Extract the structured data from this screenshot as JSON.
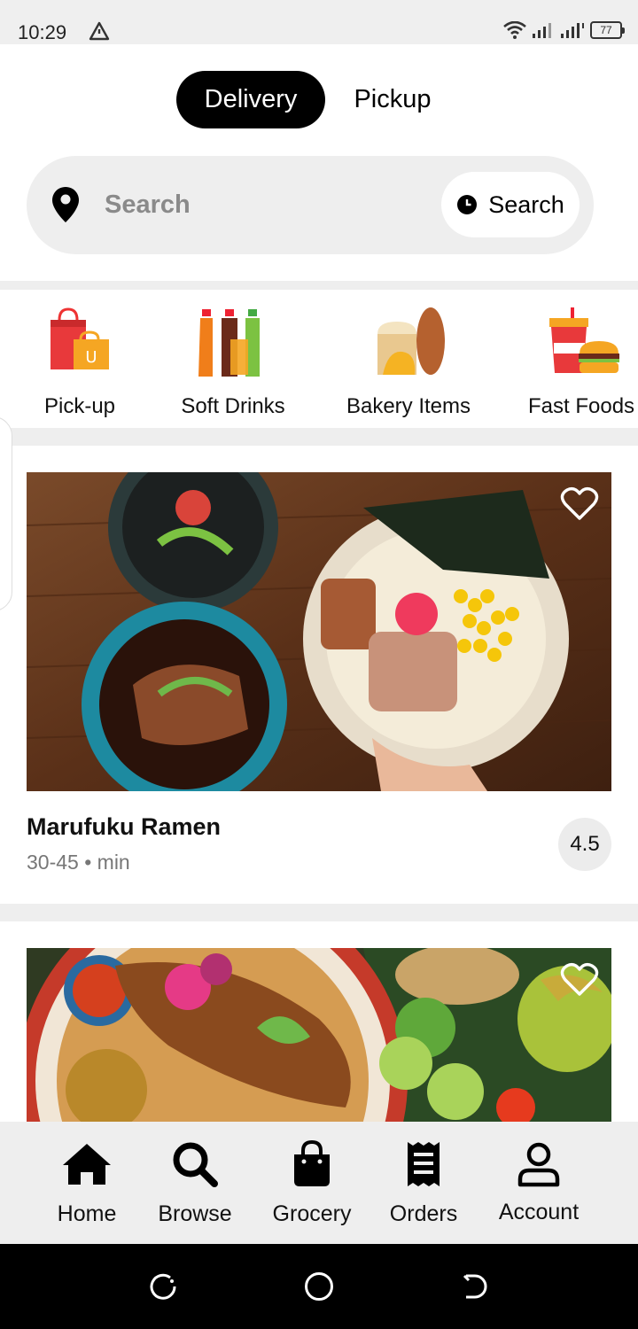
{
  "status_bar": {
    "time": "10:29",
    "battery": "77"
  },
  "mode_toggle": {
    "delivery_label": "Delivery",
    "pickup_label": "Pickup"
  },
  "search": {
    "placeholder": "Search",
    "button_label": "Search"
  },
  "categories": [
    {
      "label": "Pick-up",
      "icon": "shopping-bags-icon"
    },
    {
      "label": "Soft Drinks",
      "icon": "soft-drink-bottles-icon"
    },
    {
      "label": "Bakery Items",
      "icon": "bread-loaf-icon"
    },
    {
      "label": "Fast Foods",
      "icon": "burger-drink-icon"
    }
  ],
  "restaurants": [
    {
      "name": "Marufuku Ramen",
      "time": "30-45 • min",
      "rating": "4.5",
      "image": "ramen-bowls-photo",
      "favorited": false
    },
    {
      "name": "",
      "time": "",
      "rating": "",
      "image": "thai-fish-platter-photo",
      "favorited": false
    }
  ],
  "bottom_nav": [
    {
      "label": "Home",
      "icon": "home-icon"
    },
    {
      "label": "Browse",
      "icon": "search-icon"
    },
    {
      "label": "Grocery",
      "icon": "shopping-bag-icon"
    },
    {
      "label": "Orders",
      "icon": "receipt-icon"
    },
    {
      "label": "Account",
      "icon": "person-icon"
    }
  ],
  "colors": {
    "accent": "#000000",
    "background_gray": "#eeeeee",
    "secondary_text": "#777777"
  }
}
